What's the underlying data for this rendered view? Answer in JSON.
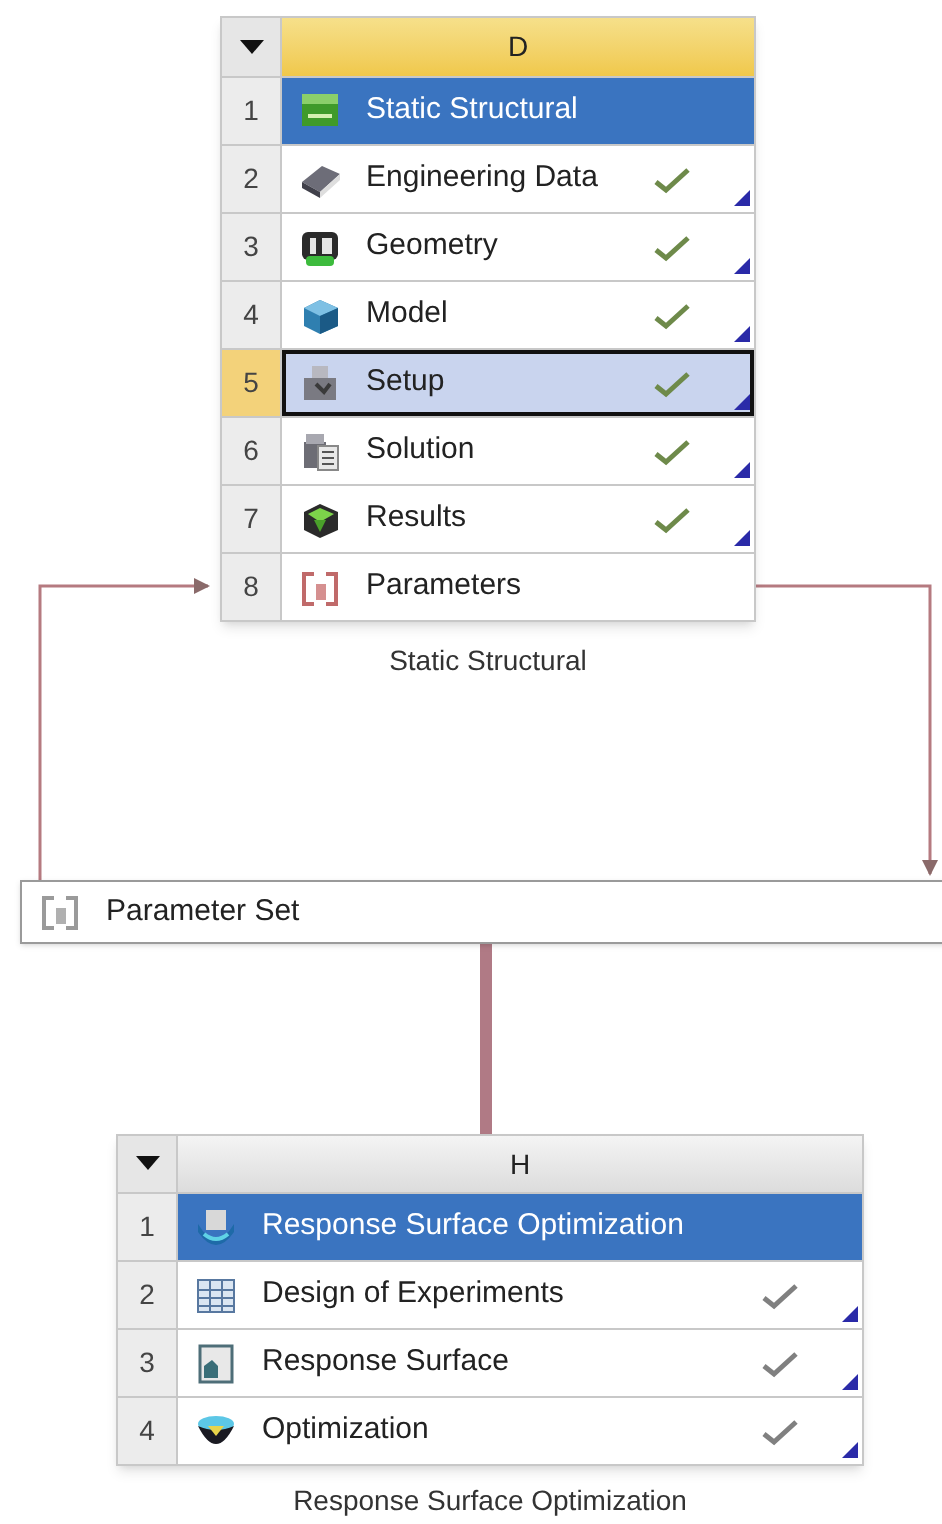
{
  "systems": [
    {
      "column": "D",
      "caption": "Static Structural",
      "rows": [
        {
          "number": "1",
          "label": "Static Structural",
          "kind": "title",
          "selected": false,
          "checked": false
        },
        {
          "number": "2",
          "label": "Engineering Data",
          "kind": "cell",
          "selected": false,
          "checked": true
        },
        {
          "number": "3",
          "label": "Geometry",
          "kind": "cell",
          "selected": false,
          "checked": true
        },
        {
          "number": "4",
          "label": "Model",
          "kind": "cell",
          "selected": false,
          "checked": true
        },
        {
          "number": "5",
          "label": "Setup",
          "kind": "cell",
          "selected": true,
          "checked": true
        },
        {
          "number": "6",
          "label": "Solution",
          "kind": "cell",
          "selected": false,
          "checked": true
        },
        {
          "number": "7",
          "label": "Results",
          "kind": "cell",
          "selected": false,
          "checked": true
        },
        {
          "number": "8",
          "label": "Parameters",
          "kind": "cell",
          "selected": false,
          "checked": false
        }
      ]
    },
    {
      "column": "H",
      "caption": "Response Surface Optimization",
      "rows": [
        {
          "number": "1",
          "label": "Response Surface Optimization",
          "kind": "title",
          "selected": false,
          "checked": false
        },
        {
          "number": "2",
          "label": "Design of Experiments",
          "kind": "cell",
          "selected": false,
          "checked": true
        },
        {
          "number": "3",
          "label": "Response Surface",
          "kind": "cell",
          "selected": false,
          "checked": true
        },
        {
          "number": "4",
          "label": "Optimization",
          "kind": "cell",
          "selected": false,
          "checked": true
        }
      ]
    }
  ],
  "parameter_set": {
    "label": "Parameter Set"
  }
}
